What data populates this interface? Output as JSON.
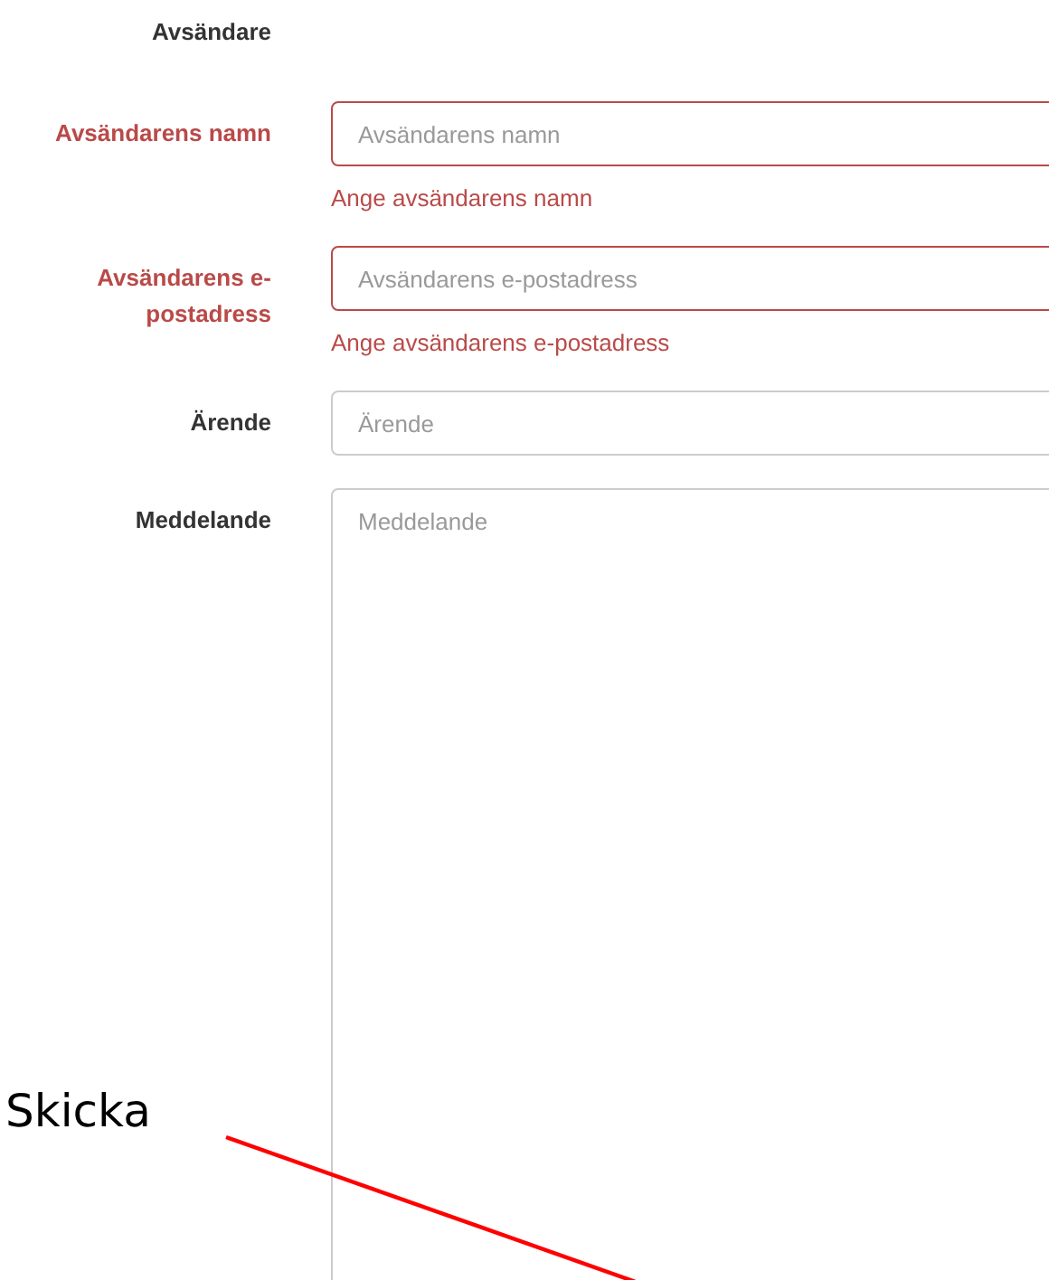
{
  "section_title": "Avsändare",
  "fields": [
    {
      "kind": "input",
      "label": "Avsändarens namn",
      "placeholder": "Avsändarens namn",
      "invalid": true,
      "error_message": "Ange avsändarens namn"
    },
    {
      "kind": "input",
      "label": "Avsändarens e-postadress",
      "placeholder": "Avsändarens e-postadress",
      "invalid": true,
      "error_message": "Ange avsändarens e-postadress"
    },
    {
      "kind": "input",
      "label": "Ärende",
      "placeholder": "Ärende",
      "invalid": false
    },
    {
      "kind": "textarea",
      "label": "Meddelande",
      "placeholder": "Meddelande",
      "invalid": false
    }
  ],
  "annotation": {
    "text": "Skicka"
  }
}
